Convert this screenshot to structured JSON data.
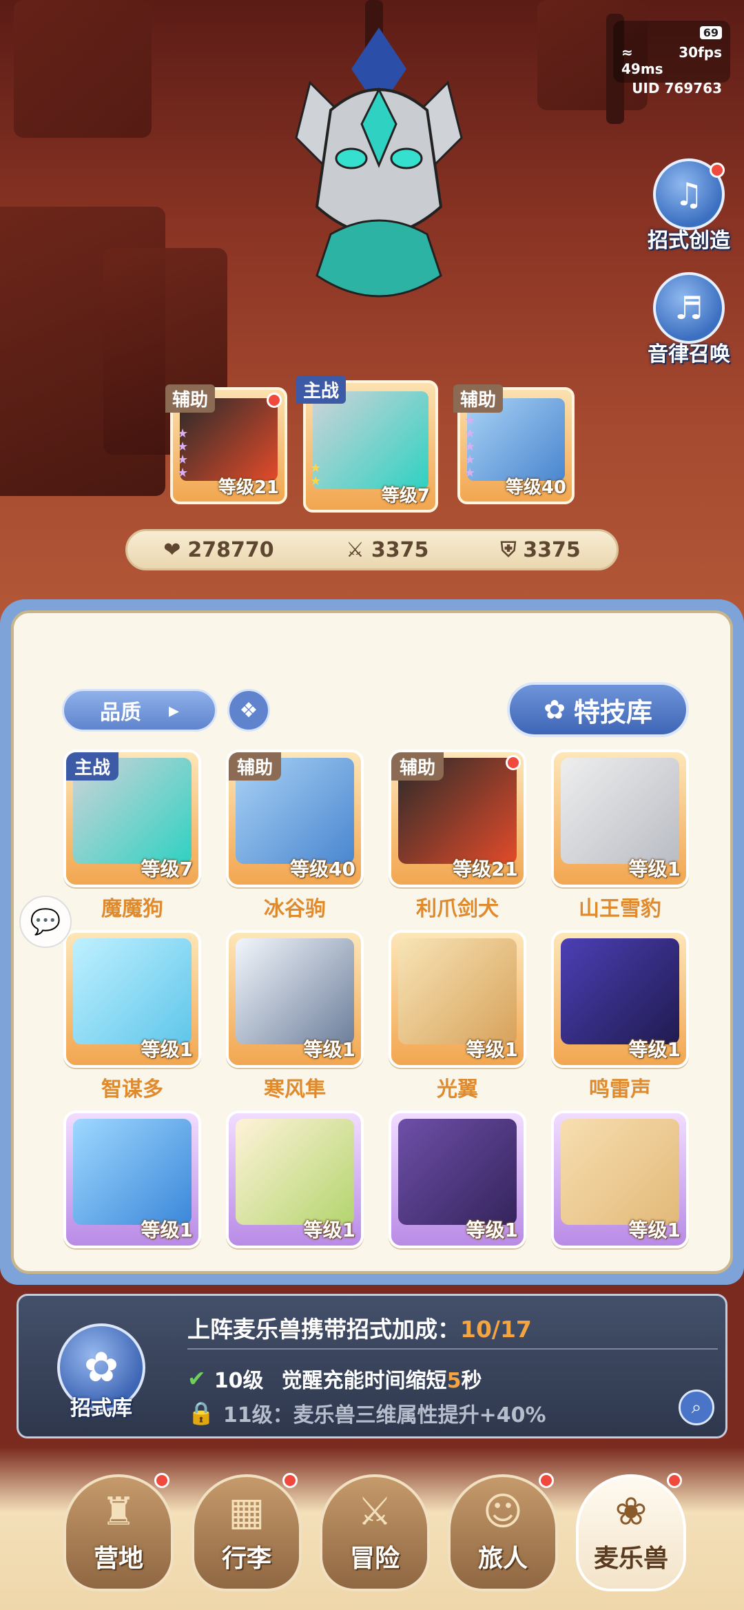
{
  "status": {
    "battery": "69",
    "ping": "49ms",
    "fps": "30fps",
    "uid": "UID 769763"
  },
  "side_buttons": [
    {
      "label": "招式创造",
      "icon": "music-book-icon",
      "has_dot": true
    },
    {
      "label": "音律召唤",
      "icon": "lyre-icon",
      "has_dot": false
    }
  ],
  "team": [
    {
      "tag": "辅助",
      "level": "等级21",
      "role": "support"
    },
    {
      "tag": "主战",
      "level": "等级7",
      "role": "main"
    },
    {
      "tag": "辅助",
      "level": "等级40",
      "role": "support"
    }
  ],
  "stats": {
    "hp": "278770",
    "attack": "3375",
    "defense": "3375"
  },
  "toolbar": {
    "quality_label": "品质",
    "skill_library_label": "特技库"
  },
  "pets": [
    {
      "name": "魔魔狗",
      "level": "等级7",
      "tag": "主战",
      "rarity": "orange"
    },
    {
      "name": "冰谷驹",
      "level": "等级40",
      "tag": "辅助",
      "rarity": "orange"
    },
    {
      "name": "利爪剑犬",
      "level": "等级21",
      "tag": "辅助",
      "rarity": "orange"
    },
    {
      "name": "山王雪豹",
      "level": "等级1",
      "tag": "",
      "rarity": "orange"
    },
    {
      "name": "智谋多",
      "level": "等级1",
      "tag": "",
      "rarity": "orange"
    },
    {
      "name": "寒风隼",
      "level": "等级1",
      "tag": "",
      "rarity": "orange"
    },
    {
      "name": "光翼",
      "level": "等级1",
      "tag": "",
      "rarity": "orange"
    },
    {
      "name": "鸣雷声",
      "level": "等级1",
      "tag": "",
      "rarity": "orange"
    },
    {
      "name": "",
      "level": "等级1",
      "tag": "",
      "rarity": "purple"
    },
    {
      "name": "",
      "level": "等级1",
      "tag": "",
      "rarity": "purple"
    },
    {
      "name": "",
      "level": "等级1",
      "tag": "",
      "rarity": "purple"
    },
    {
      "name": "",
      "level": "等级1",
      "tag": "",
      "rarity": "purple"
    }
  ],
  "bonus": {
    "icon_label": "招式库",
    "title": "上阵麦乐兽携带招式加成：",
    "progress": "10/17",
    "line1_level": "10级",
    "line1_text_a": "觉醒充能时间缩短",
    "line1_num": "5",
    "line1_text_b": "秒",
    "line2": "11级：麦乐兽三维属性提升+40%"
  },
  "nav": [
    {
      "label": "营地",
      "icon": "castle-icon",
      "has_dot": true,
      "active": false
    },
    {
      "label": "行李",
      "icon": "backpack-icon",
      "has_dot": true,
      "active": false
    },
    {
      "label": "冒险",
      "icon": "crossed-swords-icon",
      "has_dot": false,
      "active": false
    },
    {
      "label": "旅人",
      "icon": "traveler-icon",
      "has_dot": true,
      "active": false
    },
    {
      "label": "麦乐兽",
      "icon": "cat-pet-icon",
      "has_dot": true,
      "active": true
    }
  ]
}
